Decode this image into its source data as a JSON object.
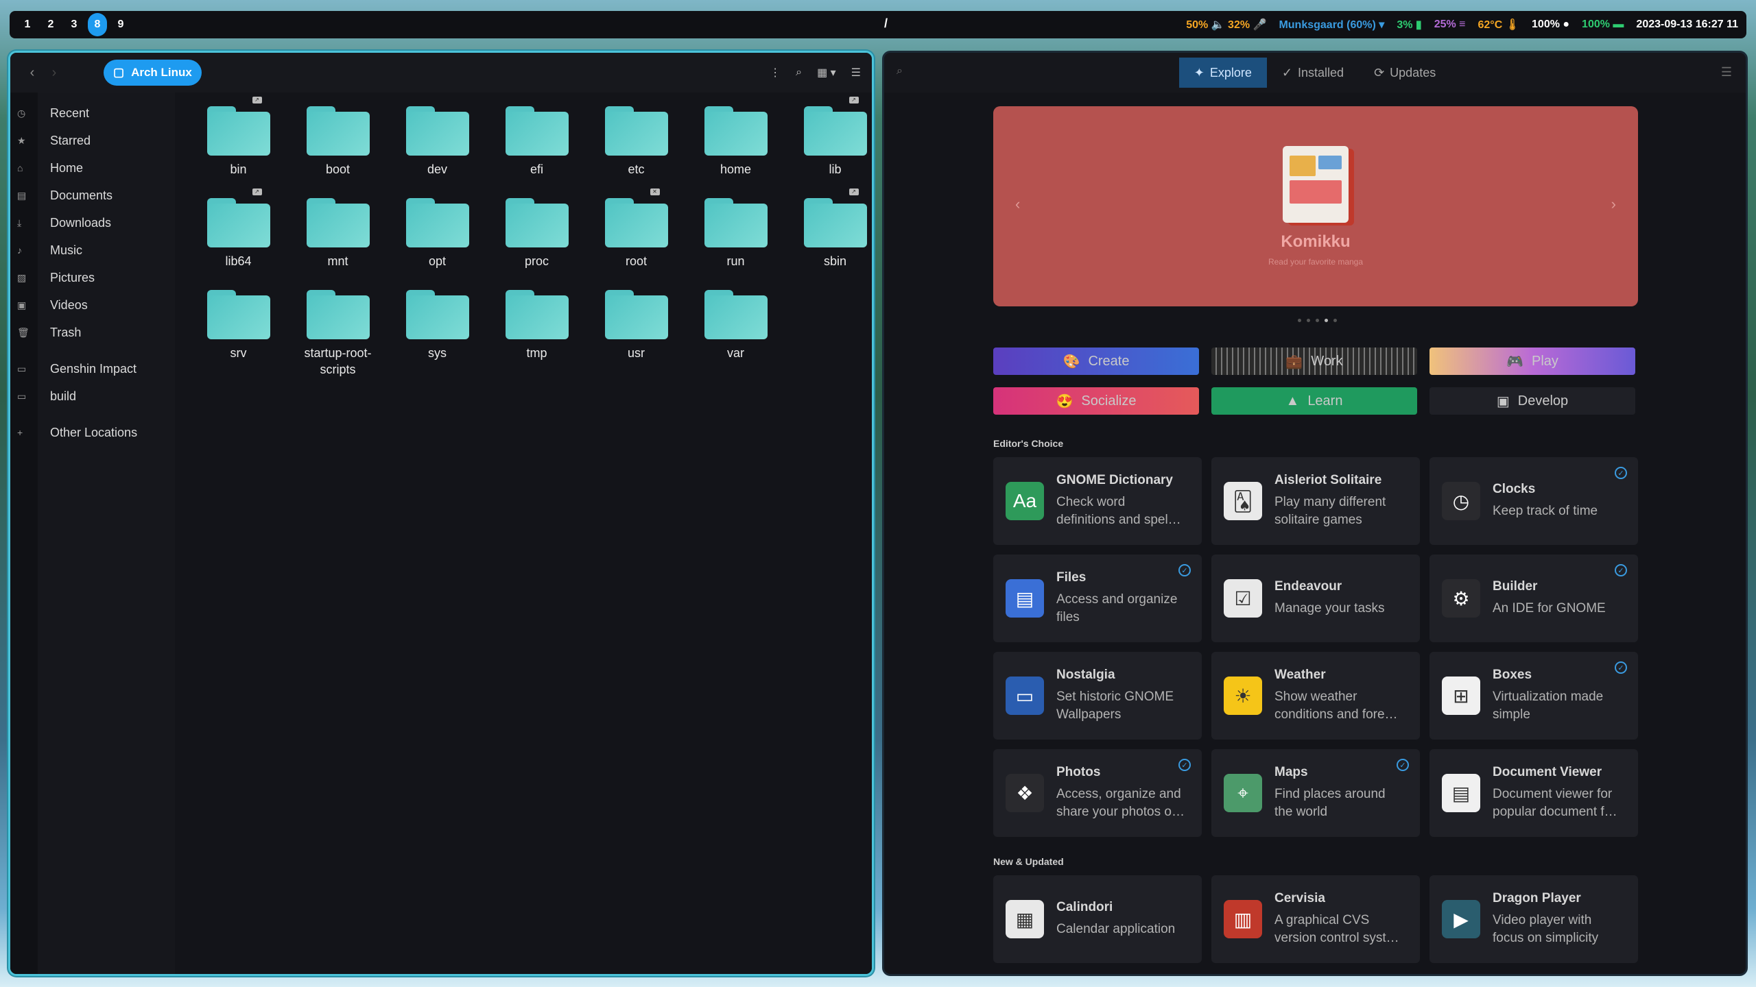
{
  "topbar": {
    "workspaces": [
      "1",
      "2",
      "3",
      "8",
      "9"
    ],
    "active_workspace": "8",
    "center_title": "/",
    "status": {
      "audio": "50%",
      "mic": "32%",
      "wifi": "Munksgaard (60%)",
      "cpu": "3%",
      "mem": "25%",
      "temp": "62°C",
      "brightness": "100%",
      "battery": "100%",
      "datetime": "2023-09-13 16:27 11"
    }
  },
  "files": {
    "path": "Arch Linux",
    "sidebar": [
      {
        "label": "Recent",
        "icon": "clock-icon"
      },
      {
        "label": "Starred",
        "icon": "star-icon"
      },
      {
        "label": "Home",
        "icon": "home-icon"
      },
      {
        "label": "Documents",
        "icon": "document-icon"
      },
      {
        "label": "Downloads",
        "icon": "download-icon"
      },
      {
        "label": "Music",
        "icon": "music-icon"
      },
      {
        "label": "Pictures",
        "icon": "picture-icon"
      },
      {
        "label": "Videos",
        "icon": "video-icon"
      },
      {
        "label": "Trash",
        "icon": "trash-icon"
      },
      {
        "label": "Genshin Impact",
        "icon": "folder-icon"
      },
      {
        "label": "build",
        "icon": "folder-icon"
      },
      {
        "label": "Other Locations",
        "icon": "plus-icon"
      }
    ],
    "folders": [
      "bin",
      "boot",
      "dev",
      "efi",
      "etc",
      "home",
      "lib",
      "lib64",
      "mnt",
      "opt",
      "proc",
      "root",
      "run",
      "sbin",
      "srv",
      "startup-root-scripts",
      "sys",
      "tmp",
      "usr",
      "var"
    ]
  },
  "software": {
    "tabs": [
      "Explore",
      "Installed",
      "Updates"
    ],
    "active_tab": "Explore",
    "banner": {
      "name": "Komikku",
      "subtitle": "Read your favorite manga"
    },
    "categories": [
      "Create",
      "Work",
      "Play",
      "Socialize",
      "Learn",
      "Develop"
    ],
    "editors_choice_label": "Editor's Choice",
    "new_updated_label": "New & Updated",
    "editors_choice": [
      {
        "title": "GNOME Dictionary",
        "desc": "Check word definitions and spel…",
        "installed": false
      },
      {
        "title": "Aisleriot Solitaire",
        "desc": "Play many different solitaire games",
        "installed": false
      },
      {
        "title": "Clocks",
        "desc": "Keep track of time",
        "installed": true
      },
      {
        "title": "Files",
        "desc": "Access and organize files",
        "installed": true
      },
      {
        "title": "Endeavour",
        "desc": "Manage your tasks",
        "installed": false
      },
      {
        "title": "Builder",
        "desc": "An IDE for GNOME",
        "installed": true
      },
      {
        "title": "Nostalgia",
        "desc": "Set historic GNOME Wallpapers",
        "installed": false
      },
      {
        "title": "Weather",
        "desc": "Show weather conditions and fore…",
        "installed": false
      },
      {
        "title": "Boxes",
        "desc": "Virtualization made simple",
        "installed": true
      },
      {
        "title": "Photos",
        "desc": "Access, organize and share your photos o…",
        "installed": true
      },
      {
        "title": "Maps",
        "desc": "Find places around the world",
        "installed": true
      },
      {
        "title": "Document Viewer",
        "desc": "Document viewer for popular document f…",
        "installed": false
      }
    ],
    "new_updated": [
      {
        "title": "Calindori",
        "desc": "Calendar application",
        "installed": false
      },
      {
        "title": "Cervisia",
        "desc": "A graphical CVS version control syst…",
        "installed": false
      },
      {
        "title": "Dragon Player",
        "desc": "Video player with focus on simplicity",
        "installed": false
      }
    ]
  }
}
